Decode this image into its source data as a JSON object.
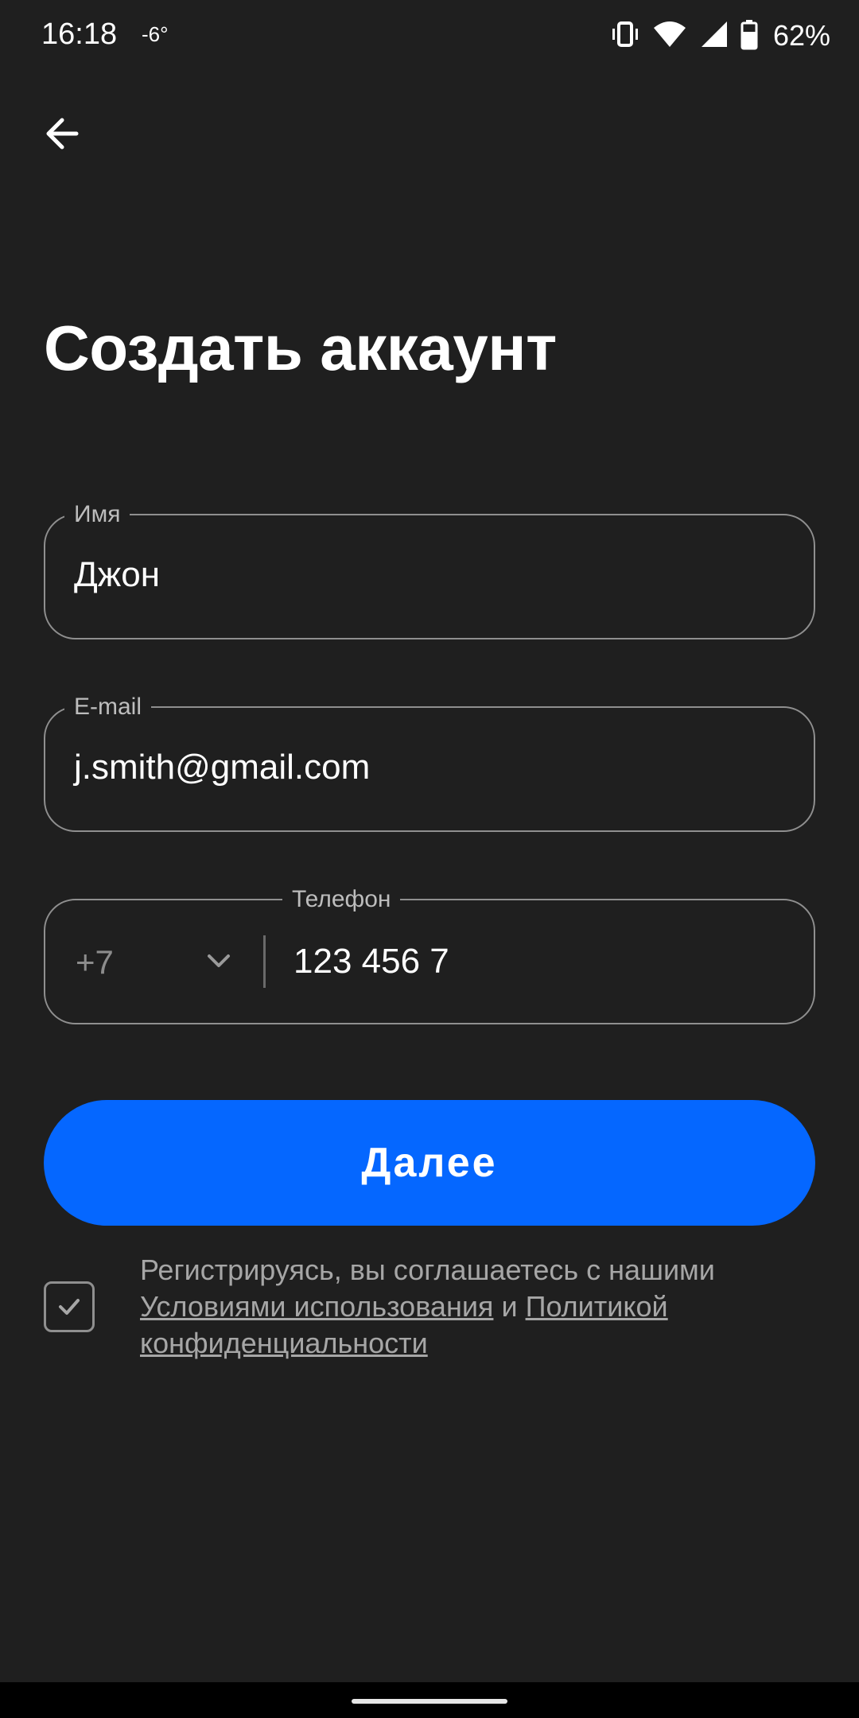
{
  "status_bar": {
    "time": "16:18",
    "temperature": "-6°",
    "battery": "62%",
    "icons": [
      "vibrate-icon",
      "wifi-icon",
      "signal-icon",
      "battery-icon"
    ]
  },
  "header": {
    "back_icon": "arrow-left-icon"
  },
  "title": "Создать аккаунт",
  "form": {
    "name": {
      "label": "Имя",
      "value": "Джон"
    },
    "email": {
      "label": "E-mail",
      "value": "j.smith@gmail.com"
    },
    "phone": {
      "label": "Телефон",
      "country_code": "+7",
      "value": "123 456 7"
    }
  },
  "next_button": {
    "label": "Далее",
    "color": "#0567ff"
  },
  "consent": {
    "checked": true,
    "text_before": "Регистрируясь, вы соглашаетесь с нашими ",
    "terms_link": "Условиями использования",
    "conjunction": " и ",
    "privacy_link": "Политикой конфиденциальности"
  },
  "colors": {
    "background": "#1f1f1f",
    "accent": "#0567ff",
    "border": "#8f8f8f"
  }
}
